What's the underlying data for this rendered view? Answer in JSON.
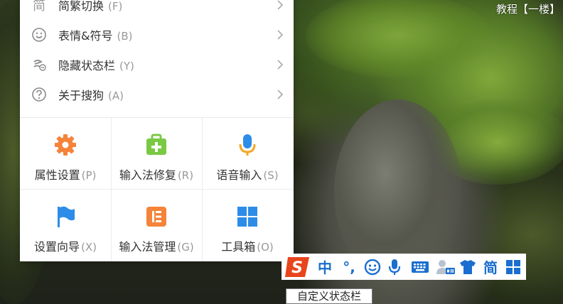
{
  "desktop": {
    "corner_text": "教程【一楼】"
  },
  "menu": {
    "items": [
      {
        "label": "简繁切换",
        "key": "(F)",
        "icon": "jian-char-icon"
      },
      {
        "label": "表情&符号",
        "key": "(B)",
        "icon": "smiley-icon"
      },
      {
        "label": "隐藏状态栏",
        "key": "(Y)",
        "icon": "hide-statusbar-icon"
      },
      {
        "label": "关于搜狗",
        "key": "(A)",
        "icon": "help-circle-icon"
      }
    ],
    "grid": [
      {
        "label": "属性设置",
        "key": "(P)",
        "icon": "gear-icon",
        "color": "#f5833a"
      },
      {
        "label": "输入法修复",
        "key": "(R)",
        "icon": "medkit-icon",
        "color": "#7ac943"
      },
      {
        "label": "语音输入",
        "key": "(S)",
        "icon": "microphone-icon",
        "color": "#2d8ce8"
      },
      {
        "label": "设置向导",
        "key": "(X)",
        "icon": "flag-icon",
        "color": "#2d8ce8"
      },
      {
        "label": "输入法管理",
        "key": "(G)",
        "icon": "manage-list-icon",
        "color": "#f5833a"
      },
      {
        "label": "工具箱",
        "key": "(O)",
        "icon": "toolbox-grid-icon",
        "color": "#2d8ce8"
      }
    ]
  },
  "statusbar": {
    "logo": "S",
    "mode": "中",
    "punct": "°,",
    "jian": "简",
    "items": [
      "sogou-logo-icon",
      "chinese-mode",
      "punctuation-mode",
      "smiley-icon",
      "microphone-icon",
      "keyboard-icon",
      "user-card-icon",
      "skin-shirt-icon",
      "simplified-toggle",
      "toolbox-grid-icon"
    ]
  },
  "tooltip": {
    "text": "自定义状态栏"
  },
  "colors": {
    "accent_blue": "#1a6ecf",
    "accent_orange": "#f5833a",
    "accent_green": "#7ac943"
  }
}
